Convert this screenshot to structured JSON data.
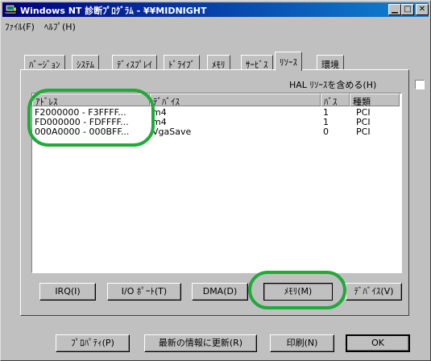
{
  "window": {
    "title": "Windows NT 診断ﾌﾟﾛｸﾞﾗﾑ - ¥¥MIDNIGHT",
    "icon": "computer-icon",
    "minimize_label": "▁",
    "maximize_label": "□",
    "close_label": "✕"
  },
  "menu": {
    "items": [
      "ﾌｧｲﾙ(F)",
      "ﾍﾙﾌﾟ(H)"
    ]
  },
  "tabs": {
    "items": [
      "ﾊﾞｰｼﾞｮﾝ",
      "ｼｽﾃﾑ",
      "ﾃﾞｨｽﾌﾟﾚｲ",
      "ﾄﾞﾗｲﾌﾞ",
      "ﾒﾓﾘ",
      "ｻｰﾋﾞｽ",
      "ﾘｿｰｽ",
      "環境"
    ],
    "active": "ﾘｿｰｽ"
  },
  "hal": {
    "label": "HAL ﾘｿｰｽを含める(H)",
    "checked": false
  },
  "list": {
    "columns": [
      "ｱﾄﾞﾚｽ",
      "ﾃﾞﾊﾞｲｽ",
      "ﾊﾞｽ",
      "種類"
    ],
    "rows": [
      [
        "F2000000 - F3FFFF...",
        "m4",
        "1",
        "PCI"
      ],
      [
        "FD000000 - FDFFFF...",
        "m4",
        "1",
        "PCI"
      ],
      [
        "000A0000 - 000BFF...",
        "VgaSave",
        "0",
        "PCI"
      ]
    ]
  },
  "resource_buttons": {
    "irq": "IRQ(I)",
    "io_port": "I/O ﾎﾟｰﾄ(T)",
    "dma": "DMA(D)",
    "memory": "ﾒﾓﾘ(M)",
    "device": "ﾃﾞﾊﾞｲｽ(V)"
  },
  "bottom_buttons": {
    "properties": "ﾌﾟﾛﾊﾟﾃｨ(P)",
    "refresh": "最新の情報に更新(R)",
    "print": "印刷(N)",
    "ok": "OK"
  },
  "colors": {
    "title_start": "#000080",
    "title_end": "#1084d0",
    "face": "#c0c0c0",
    "annotation": "#1faa3a"
  }
}
